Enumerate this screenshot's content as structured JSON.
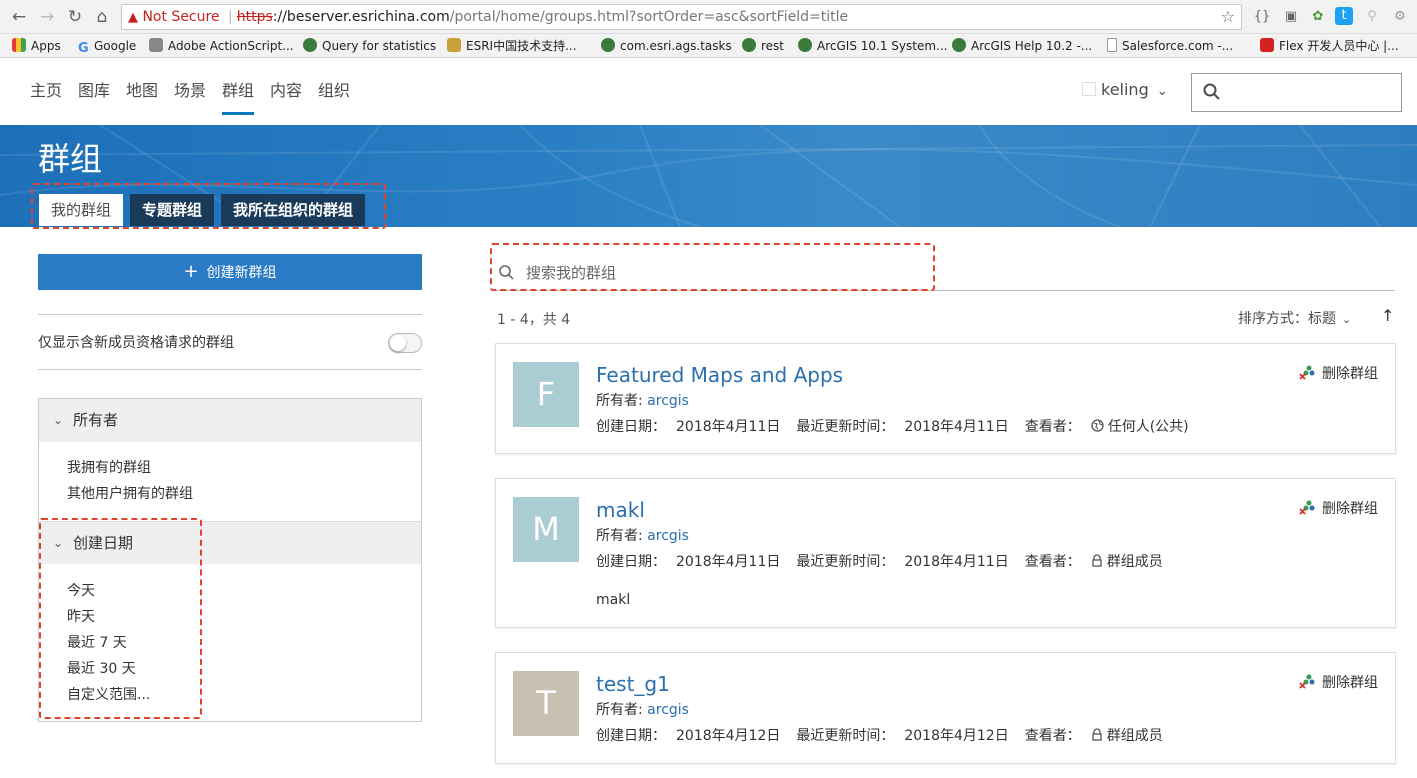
{
  "browser": {
    "security_label": "Not Secure",
    "url_scheme": "https",
    "url_host": "://beserver.esrichina.com",
    "url_path": "/portal/home/groups.html?sortOrder=asc&sortField=title",
    "bookmarks": [
      "Apps",
      "Google",
      "Adobe ActionScript...",
      "Query for statistics",
      "ESRI中国技术支持...",
      "com.esri.ags.tasks",
      "rest",
      "ArcGIS 10.1 System...",
      "ArcGIS Help 10.2 -...",
      "Salesforce.com -...",
      "Flex 开发人员中心 |..."
    ]
  },
  "nav": {
    "items": [
      "主页",
      "图库",
      "地图",
      "场景",
      "群组",
      "内容",
      "组织"
    ],
    "active_index": 4,
    "username": "keling"
  },
  "banner": {
    "title": "群组",
    "tabs": [
      "我的群组",
      "专题群组",
      "我所在组织的群组"
    ]
  },
  "sidebar": {
    "create_label": "创建新群组",
    "toggle_label": "仅显示含新成员资格请求的群组",
    "owner_facet": {
      "title": "所有者",
      "items": [
        "我拥有的群组",
        "其他用户拥有的群组"
      ]
    },
    "date_facet": {
      "title": "创建日期",
      "items": [
        "今天",
        "昨天",
        "最近 7 天",
        "最近 30 天",
        "自定义范围..."
      ]
    }
  },
  "content": {
    "search_placeholder": "搜索我的群组",
    "count_text": "1 - 4，共 4",
    "sort_label": "排序方式：",
    "sort_value": "标题",
    "owner_label": "所有者:",
    "created_label": "创建日期：",
    "modified_label": "最近更新时间：",
    "viewers_label": "查看者：",
    "delete_label": "删除群组",
    "groups": [
      {
        "letter": "F",
        "thumb_color": "#a9cdd3",
        "title": "Featured Maps and Apps",
        "owner": "arcgis",
        "created": "2018年4月11日",
        "modified": "2018年4月11日",
        "viewers": "任何人(公共)",
        "viewers_icon": "globe-icon",
        "description": ""
      },
      {
        "letter": "M",
        "thumb_color": "#a9cdd3",
        "title": "makl",
        "owner": "arcgis",
        "created": "2018年4月11日",
        "modified": "2018年4月11日",
        "viewers": "群组成员",
        "viewers_icon": "lock-icon",
        "description": "makl"
      },
      {
        "letter": "T",
        "thumb_color": "#c8c0b0",
        "title": "test_g1",
        "owner": "arcgis",
        "created": "2018年4月12日",
        "modified": "2018年4月12日",
        "viewers": "群组成员",
        "viewers_icon": "lock-icon",
        "description": ""
      }
    ]
  },
  "colors": {
    "accent": "#2a7ac6",
    "link": "#2a6fb0",
    "annotation": "#e0442b"
  }
}
